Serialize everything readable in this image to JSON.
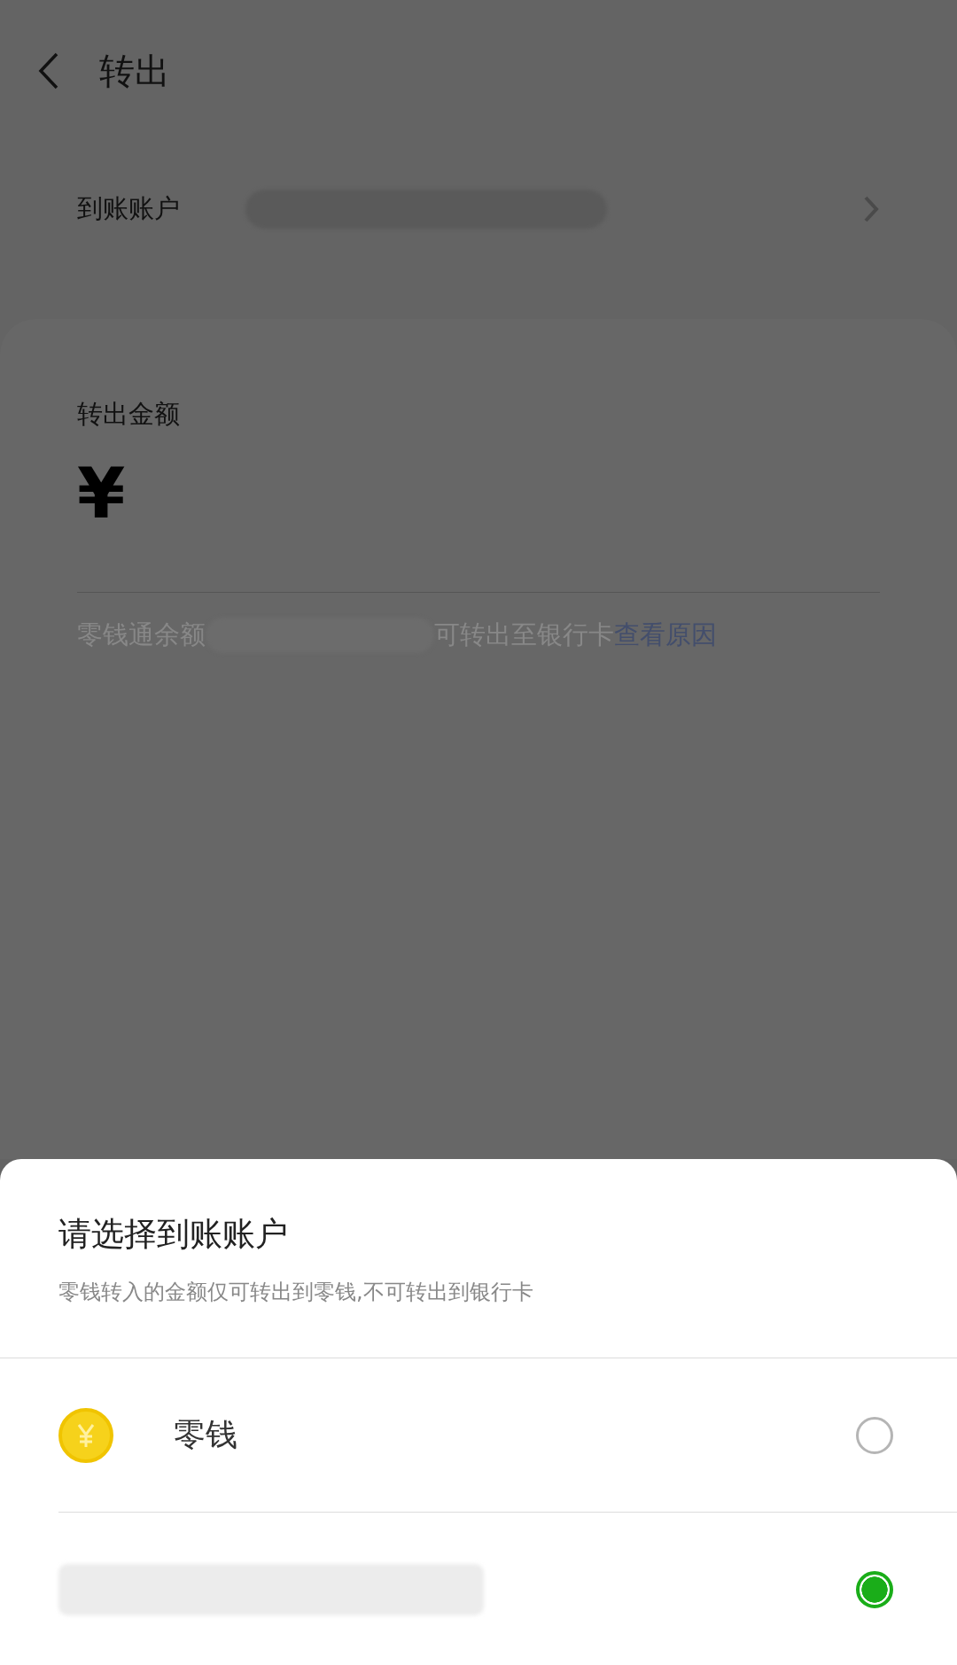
{
  "header": {
    "title": "转出"
  },
  "account_row": {
    "label": "到账账户"
  },
  "amount_card": {
    "label": "转出金额",
    "currency": "¥",
    "note_start": "零钱通余额",
    "note_end": "可转出至银行卡",
    "note_link": "查看原因"
  },
  "sheet": {
    "title": "请选择到账账户",
    "subtitle": "零钱转入的金额仅可转出到零钱,不可转出到银行卡",
    "options": [
      {
        "kind": "wallet",
        "label": "零钱",
        "selected": false
      },
      {
        "kind": "redacted",
        "selected": true
      }
    ]
  }
}
